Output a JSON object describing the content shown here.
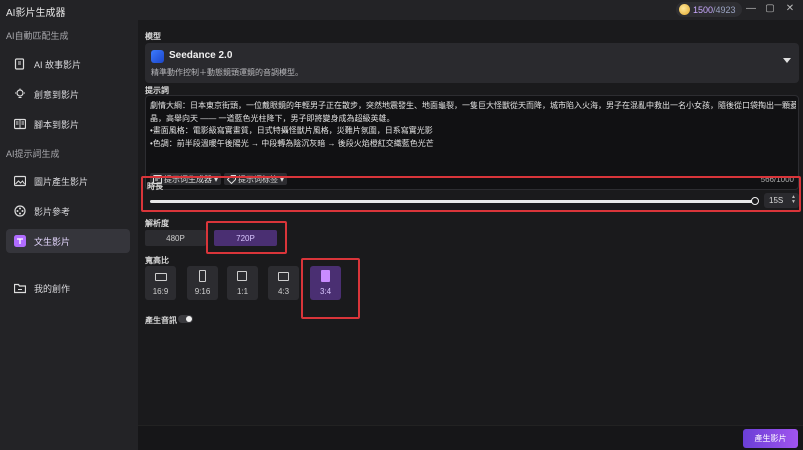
{
  "window": {
    "title": "AI影片生成器",
    "credits_used": "1500",
    "credits_total": "/4923"
  },
  "sidebar": {
    "section1": "AI自動匹配生成",
    "section2": "AI提示詞生成",
    "items": [
      {
        "label": "AI 故事影片",
        "icon": "ai-story-icon"
      },
      {
        "label": "創意到影片",
        "icon": "lightbulb-icon"
      },
      {
        "label": "腳本到影片",
        "icon": "book-icon"
      },
      {
        "label": "圖片產生影片",
        "icon": "image-icon"
      },
      {
        "label": "影片參考",
        "icon": "film-icon"
      },
      {
        "label": "文生影片",
        "icon": "text-to-video-icon"
      },
      {
        "label": "我的創作",
        "icon": "folder-icon"
      }
    ]
  },
  "model": {
    "label": "模型",
    "name": "Seedance 2.0",
    "desc": "精準動作控制＋動態鏡頭運鏡的音調模型。"
  },
  "prompt": {
    "label": "提示詞",
    "lines": [
      "劇情大綱：日本東京街頭，一位戴眼鏡的年輕男子正在散步，突然地震發生、地面龜裂，一隻巨大怪獸從天而降，城市陷入火海，男子在混亂中救出一名小女孩，隨後從口袋掏出一顆菱形發光水",
      "晶，高舉向天 —— 一道藍色光柱降下，男子即將變身成為超級英雄。",
      "•畫面風格：電影級寫實畫質，日式特攝怪獸片風格，災難片氛圍，日系寫實光影",
      "•色調：前半段溫暖午後陽光 → 中段轉為陰沉灰暗 → 後段火焰橙紅交織藍色光芒"
    ],
    "tool1": "提示词生成器",
    "tool2": "提示词标签",
    "counter": "566/1000"
  },
  "duration": {
    "label": "時長",
    "value": "15S",
    "slider_fraction": 1.0
  },
  "resolution": {
    "label": "解析度",
    "options": [
      "480P",
      "720P"
    ],
    "selected": "720P"
  },
  "ratio": {
    "label": "寬高比",
    "options": [
      "16:9",
      "9:16",
      "1:1",
      "4:3",
      "3:4"
    ],
    "selected": "3:4"
  },
  "audio": {
    "label": "產生音訊",
    "enabled": false
  },
  "generate_label": "產生影片",
  "colors": {
    "accent": "#a154ef",
    "selected_bg": "#4a2f72",
    "highlight_box": "#d9353a"
  }
}
